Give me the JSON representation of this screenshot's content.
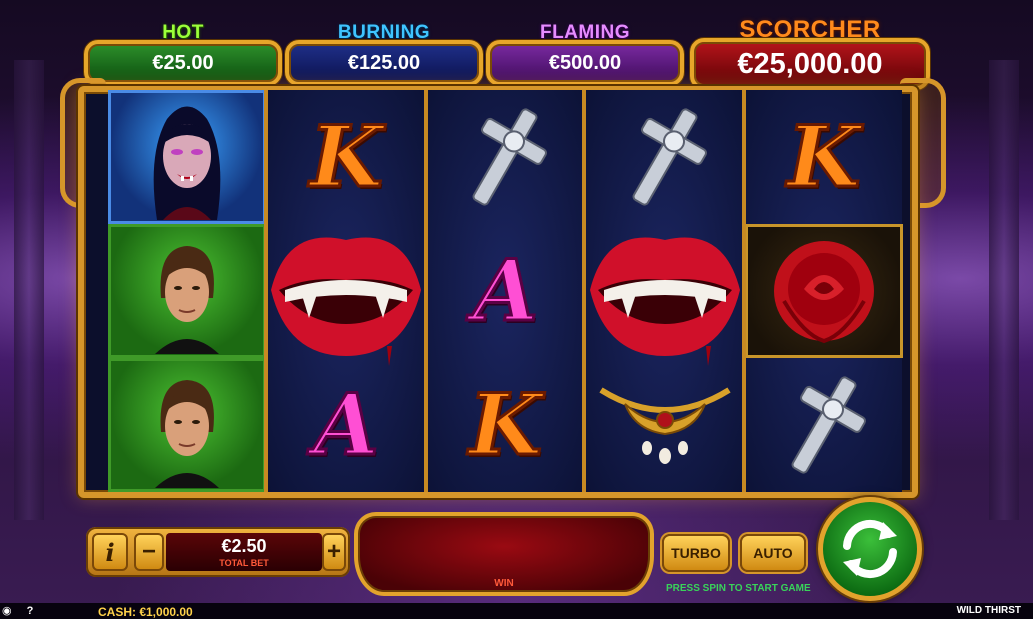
{
  "jackpots": {
    "hot": {
      "label": "HOT",
      "value": "€25.00"
    },
    "burning": {
      "label": "BURNING",
      "value": "€125.00"
    },
    "flaming": {
      "label": "FLAMING",
      "value": "€500.00"
    },
    "scorcher": {
      "label": "SCORCHER",
      "value": "€25,000.00"
    }
  },
  "reels": [
    [
      "vampire-woman",
      "vampire-man",
      "vampire-man"
    ],
    [
      "K",
      "lips",
      "A"
    ],
    [
      "cross",
      "A",
      "K"
    ],
    [
      "cross",
      "lips",
      "necklace"
    ],
    [
      "K",
      "rose",
      "cross"
    ]
  ],
  "controls": {
    "info": "i",
    "minus": "−",
    "plus": "+",
    "bet_value": "€2.50",
    "bet_label": "TOTAL BET",
    "win_label": "WIN",
    "turbo": "TURBO",
    "auto": "AUTO",
    "hint": "PRESS SPIN TO START GAME"
  },
  "footer": {
    "cash": "CASH:  €1,000.00",
    "game_name": "WILD THIRST",
    "help": "?"
  },
  "colors": {
    "gold": "#d6962a",
    "hot": "#9cff3a",
    "burning": "#3fc4ff",
    "flaming": "#e68cff",
    "scorcher": "#ff8a1c",
    "spin_green": "#0c6a12"
  }
}
